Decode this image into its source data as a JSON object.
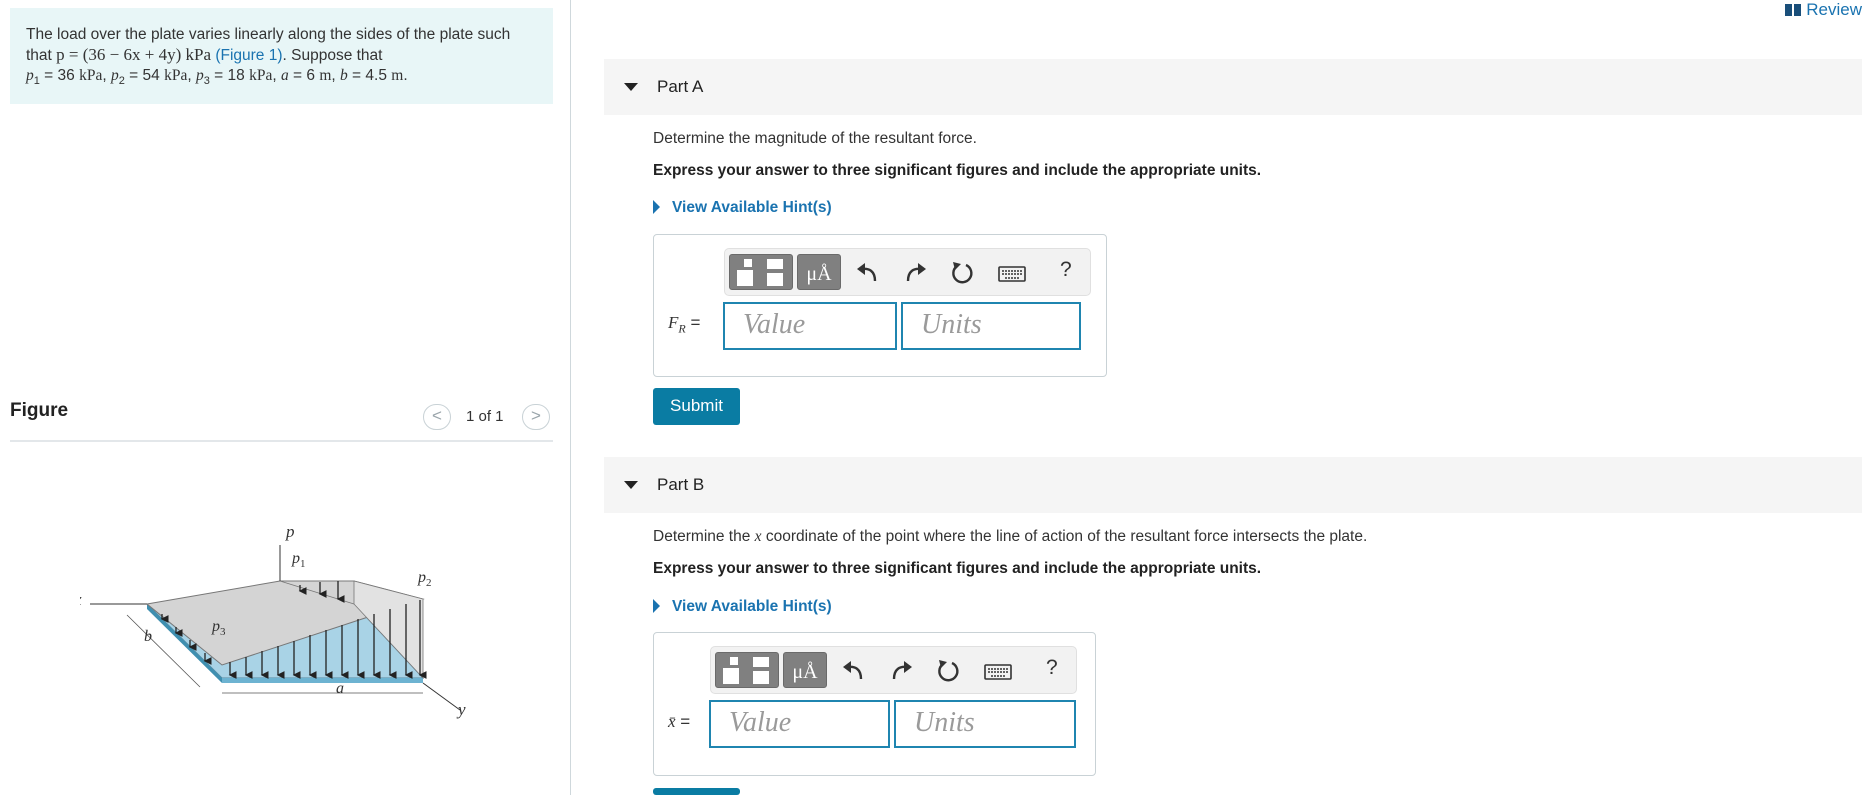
{
  "problem": {
    "text1": "The load over the plate varies linearly along the sides of the plate such",
    "text2_pre": "that ",
    "formula": "p = (36 − 6x + 4y) kPa",
    "figure_link": "(Figure 1)",
    "text2_post": ". Suppose that",
    "p1": "36",
    "p2": "54",
    "p3": "18",
    "a": "6",
    "b": "4.5"
  },
  "figure": {
    "title": "Figure",
    "page": "1 of 1",
    "prev": "<",
    "next": ">",
    "labels": {
      "p": "p",
      "p1": "p",
      "p2": "p",
      "p3": "p",
      "s1": "1",
      "s2": "2",
      "s3": "3",
      "x": "x",
      "y": "y",
      "a": "a",
      "b": "b"
    }
  },
  "header": {
    "review": "Review"
  },
  "partA": {
    "title": "Part A",
    "question": "Determine the magnitude of the resultant force.",
    "instruction": "Express your answer to three significant figures and include the appropriate units.",
    "hint": "View Available Hint(s)",
    "label_main": "F",
    "label_sub": "R",
    "label_eq": " =",
    "value_placeholder": "Value",
    "units_placeholder": "Units",
    "submit": "Submit"
  },
  "partB": {
    "title": "Part B",
    "question_pre": "Determine the ",
    "question_var": "x",
    "question_post": " coordinate of the point where the line of action of the resultant force intersects the plate.",
    "instruction": "Express your answer to three significant figures and include the appropriate units.",
    "hint": "View Available Hint(s)",
    "label_main": "x̄",
    "label_eq": " =",
    "value_placeholder": "Value",
    "units_placeholder": "Units"
  },
  "toolbar": {
    "mu_label": "μÅ",
    "help_label": "?"
  },
  "colors": {
    "accent": "#1a73b0",
    "submit": "#0a7ca3",
    "input_border": "#1f85b0",
    "problem_bg": "#e8f6f7"
  },
  "icons": [
    "templates-icon",
    "units-icon",
    "undo-icon",
    "redo-icon",
    "reset-icon",
    "keyboard-icon",
    "help-icon",
    "review-book-icon"
  ]
}
